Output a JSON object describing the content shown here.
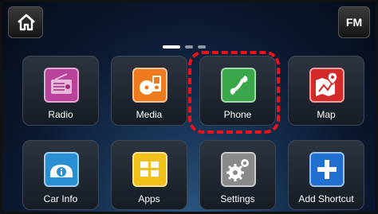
{
  "topbar": {
    "fm_label": "FM"
  },
  "pager": {
    "pages": 3,
    "active": 1
  },
  "tiles": [
    {
      "label": "Radio",
      "icon": "radio-icon",
      "color": "#b9429a"
    },
    {
      "label": "Media",
      "icon": "media-icon",
      "color": "#f07a1e"
    },
    {
      "label": "Phone",
      "icon": "phone-icon",
      "color": "#3aa84a"
    },
    {
      "label": "Map",
      "icon": "map-icon",
      "color": "#d42a2a"
    },
    {
      "label": "Car Info",
      "icon": "car-info-icon",
      "color": "#2a8fd2"
    },
    {
      "label": "Apps",
      "icon": "apps-icon",
      "color": "#f2c21a"
    },
    {
      "label": "Settings",
      "icon": "settings-icon",
      "color": "#8a8a8a"
    },
    {
      "label": "Add Shortcut",
      "icon": "add-icon",
      "color": "#1f6fd0"
    }
  ],
  "highlight_target": "Phone"
}
